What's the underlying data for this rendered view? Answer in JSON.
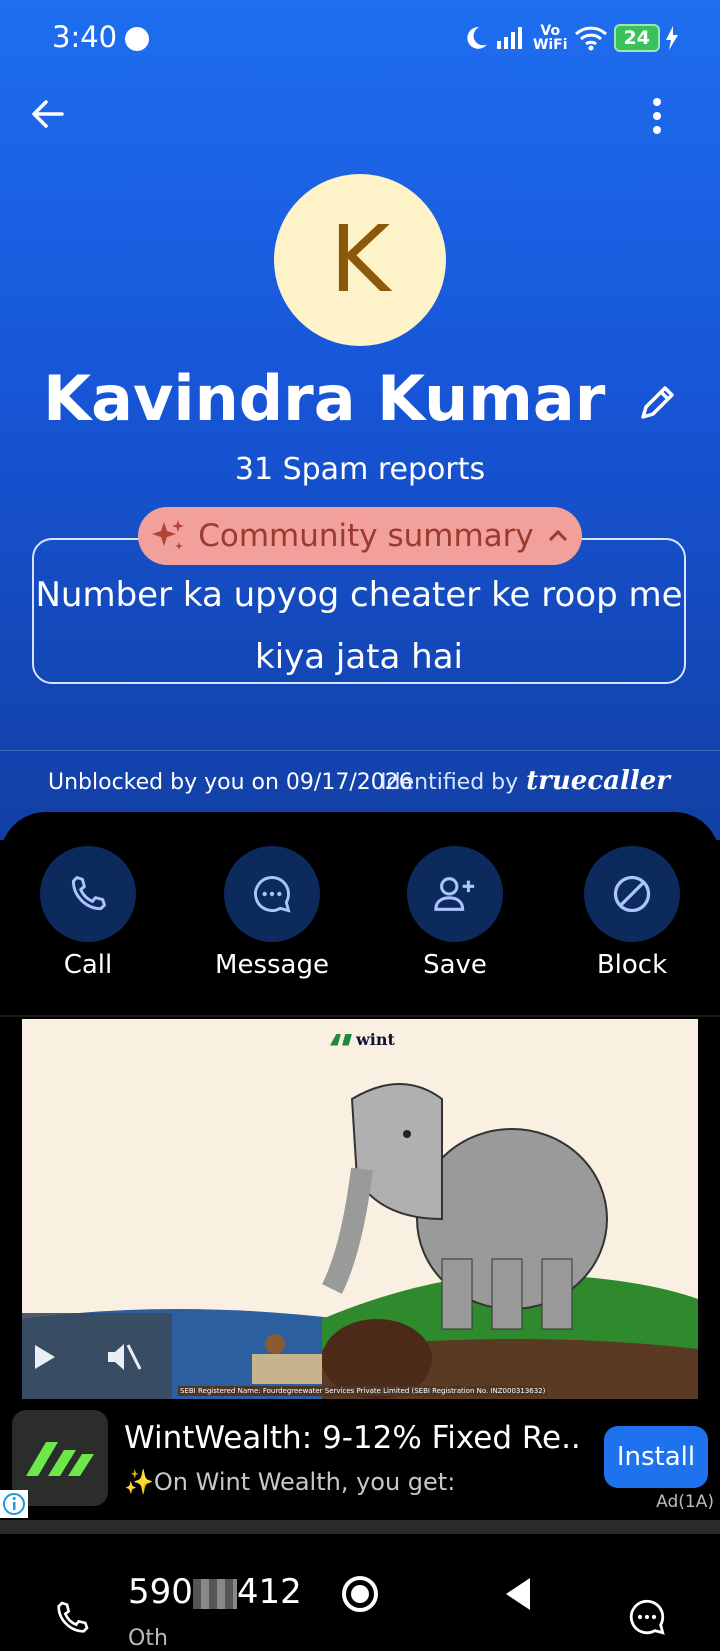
{
  "status_bar": {
    "time": "3:40",
    "network_label_top": "Vo",
    "network_label_bottom": "WiFi",
    "battery": "24"
  },
  "profile": {
    "avatar_letter": "K",
    "name": "Kavindra Kumar",
    "spam_reports": "31 Spam reports",
    "summary_pill_label": "Community summary",
    "summary_text": "Number ka upyog cheater ke roop me kiya jata hai",
    "unblocked_text": "Unblocked by you on 09/17/2026",
    "identified_prefix": "Identified by",
    "identified_brand": "truecaller"
  },
  "actions": [
    {
      "label": "Call",
      "icon": "phone-icon"
    },
    {
      "label": "Message",
      "icon": "chat-bubble-icon"
    },
    {
      "label": "Save",
      "icon": "add-contact-icon"
    },
    {
      "label": "Block",
      "icon": "block-icon"
    }
  ],
  "ad": {
    "brand_logo_text": "wint",
    "sebi_text": "SEBI Registered Name: Fourdegreewater Services Private Limited (SEBI Registration No. INZ000313632)",
    "title": "WintWealth: 9-12% Fixed Re...",
    "subtitle": "✨On Wint Wealth, you get:",
    "install_label": "Install",
    "ad_tag": "Ad(1A)"
  },
  "bottom": {
    "number_prefix": "590",
    "number_suffix": "412",
    "partial_text": "Oth"
  },
  "colors": {
    "header_blue": "#1f6ef0",
    "pill_bg": "#f2a09b",
    "install_blue": "#1e72ee",
    "avatar_bg": "#fdf2c8"
  }
}
